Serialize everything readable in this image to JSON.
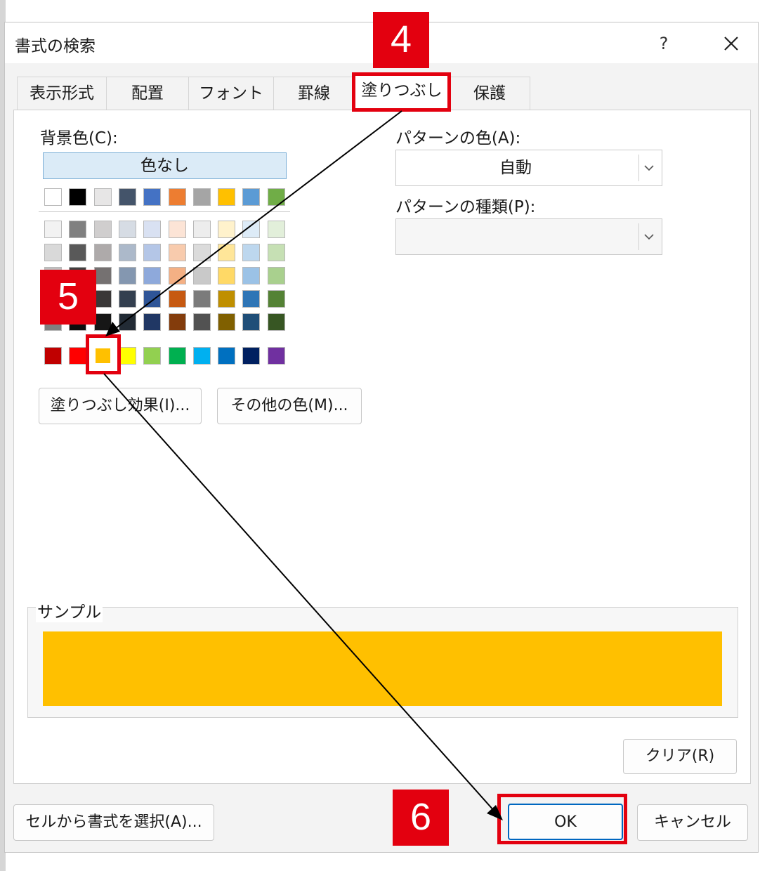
{
  "dialog": {
    "title": "書式の検索",
    "help_label": "?"
  },
  "tabs": [
    {
      "label": "表示形式"
    },
    {
      "label": "配置"
    },
    {
      "label": "フォント"
    },
    {
      "label": "罫線"
    },
    {
      "label": "塗りつぶし",
      "active": true
    },
    {
      "label": "保護"
    }
  ],
  "fill": {
    "background_label": "背景色(C):",
    "no_color_label": "色なし",
    "pattern_color_label": "パターンの色(A):",
    "pattern_color_value": "自動",
    "pattern_type_label": "パターンの種類(P):",
    "pattern_type_value": "",
    "fill_effects_label": "塗りつぶし効果(I)...",
    "more_colors_label": "その他の色(M)...",
    "sample_label": "サンプル",
    "sample_color": "#FFC000",
    "selected_color": "#FFC000"
  },
  "palette": {
    "top_row": [
      "#FFFFFF",
      "#000000",
      "#E7E6E6",
      "#44546A",
      "#4472C4",
      "#ED7D31",
      "#A5A5A5",
      "#FFC000",
      "#5B9BD5",
      "#70AD47"
    ],
    "shades": [
      [
        "#F2F2F2",
        "#808080",
        "#D0CECE",
        "#D6DCE4",
        "#D9E1F2",
        "#FCE4D6",
        "#EDEDED",
        "#FFF2CC",
        "#DDEBF7",
        "#E2EFDA"
      ],
      [
        "#D9D9D9",
        "#595959",
        "#AEAAAA",
        "#ACB9CA",
        "#B4C6E7",
        "#F8CBAD",
        "#DBDBDB",
        "#FFE699",
        "#BDD7EE",
        "#C6E0B4"
      ],
      [
        "#BFBFBF",
        "#404040",
        "#757171",
        "#8497B0",
        "#8EA9DB",
        "#F4B084",
        "#C9C9C9",
        "#FFD966",
        "#9BC2E6",
        "#A9D08E"
      ],
      [
        "#A6A6A6",
        "#262626",
        "#3A3838",
        "#333F4F",
        "#2F5597",
        "#C65911",
        "#7B7B7B",
        "#BF8F00",
        "#2E75B6",
        "#548235"
      ],
      [
        "#808080",
        "#0D0D0D",
        "#161616",
        "#222B35",
        "#203764",
        "#833C0C",
        "#525252",
        "#806000",
        "#1F4E78",
        "#375623"
      ]
    ],
    "standard": [
      "#C00000",
      "#FF0000",
      "#FFC000",
      "#FFFF00",
      "#92D050",
      "#00B050",
      "#00B0F0",
      "#0070C0",
      "#002060",
      "#7030A0"
    ]
  },
  "buttons": {
    "clear_label": "クリア(R)",
    "pick_from_cell_label": "セルから書式を選択(A)...",
    "ok_label": "OK",
    "cancel_label": "キャンセル"
  },
  "annotations": {
    "step4": "4",
    "step5": "5",
    "step6": "6",
    "highlight_color": "#E3000F"
  }
}
